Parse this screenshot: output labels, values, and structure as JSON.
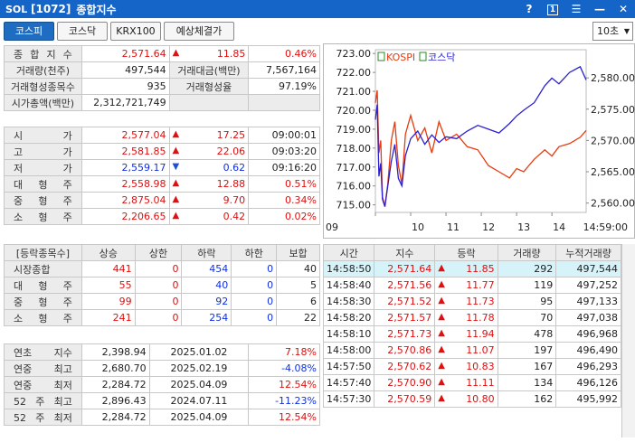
{
  "titlebar": {
    "logo": "SOL",
    "code": "[1072]",
    "title": "종합지수",
    "help": "?",
    "badge": "1",
    "menu": "☰",
    "minimize": "—",
    "close": "✕"
  },
  "tabs": [
    "코스피",
    "코스닥",
    "KRX100",
    "예상체결가"
  ],
  "interval": "10초",
  "summary": {
    "r1": {
      "l": "종 합 지 수",
      "v": "2,571.64",
      "chg": "11.85",
      "pct": "0.46%"
    },
    "r2": {
      "l1": "거래량(천주)",
      "v1": "497,544",
      "l2": "거래대금(백만)",
      "v2": "7,567,164"
    },
    "r3": {
      "l1": "거래형성종목수",
      "v1": "935",
      "l2": "거래형성율",
      "v2": "97.19%"
    },
    "r4": {
      "l1": "시가총액(백만)",
      "v1": "2,312,721,749"
    }
  },
  "ohlc": [
    {
      "l": "시 가",
      "v": "2,577.04",
      "d": "up",
      "chg": "17.25",
      "extra": "09:00:01",
      "vc": "red",
      "xc": "blk"
    },
    {
      "l": "고 가",
      "v": "2,581.85",
      "d": "up",
      "chg": "22.06",
      "extra": "09:03:20",
      "vc": "red",
      "xc": "blk"
    },
    {
      "l": "저 가",
      "v": "2,559.17",
      "d": "down",
      "chg": "0.62",
      "extra": "09:16:20",
      "vc": "blue",
      "xc": "blk"
    },
    {
      "l": "대 형 주",
      "v": "2,558.98",
      "d": "up",
      "chg": "12.88",
      "extra": "0.51%",
      "vc": "red",
      "xc": "red"
    },
    {
      "l": "중 형 주",
      "v": "2,875.04",
      "d": "up",
      "chg": "9.70",
      "extra": "0.34%",
      "vc": "red",
      "xc": "red"
    },
    {
      "l": "소 형 주",
      "v": "2,206.65",
      "d": "up",
      "chg": "0.42",
      "extra": "0.02%",
      "vc": "red",
      "xc": "red"
    }
  ],
  "breadth": {
    "headers": [
      "[등락종목수]",
      "상승",
      "상한",
      "하락",
      "하한",
      "보합"
    ],
    "rows": [
      {
        "l": "시장종합",
        "up": "441",
        "uplim": "0",
        "dn": "454",
        "dnlim": "0",
        "flat": "40"
      },
      {
        "l": "대 형 주",
        "up": "55",
        "uplim": "0",
        "dn": "40",
        "dnlim": "0",
        "flat": "5"
      },
      {
        "l": "중 형 주",
        "up": "99",
        "uplim": "0",
        "dn": "92",
        "dnlim": "0",
        "flat": "6"
      },
      {
        "l": "소 형 주",
        "up": "241",
        "uplim": "0",
        "dn": "254",
        "dnlim": "0",
        "flat": "22"
      }
    ]
  },
  "yearstats": [
    {
      "l": "연초 지수",
      "v": "2,398.94",
      "date": "2025.01.02",
      "pct": "7.18%",
      "pc": "red"
    },
    {
      "l": "연중 최고",
      "v": "2,680.70",
      "date": "2025.02.19",
      "pct": "-4.08%",
      "pc": "blue"
    },
    {
      "l": "연중 최저",
      "v": "2,284.72",
      "date": "2025.04.09",
      "pct": "12.54%",
      "pc": "red"
    },
    {
      "l": "52 주 최고",
      "v": "2,896.43",
      "date": "2024.07.11",
      "pct": "-11.23%",
      "pc": "blue"
    },
    {
      "l": "52 주 최저",
      "v": "2,284.72",
      "date": "2025.04.09",
      "pct": "12.54%",
      "pc": "red"
    }
  ],
  "ticks": {
    "headers": [
      "시간",
      "지수",
      "등락",
      "거래량",
      "누적거래량"
    ],
    "rows": [
      {
        "t": "14:58:50",
        "idx": "2,571.64",
        "chg": "11.85",
        "vol": "292",
        "cum": "497,544"
      },
      {
        "t": "14:58:40",
        "idx": "2,571.56",
        "chg": "11.77",
        "vol": "119",
        "cum": "497,252"
      },
      {
        "t": "14:58:30",
        "idx": "2,571.52",
        "chg": "11.73",
        "vol": "95",
        "cum": "497,133"
      },
      {
        "t": "14:58:20",
        "idx": "2,571.57",
        "chg": "11.78",
        "vol": "70",
        "cum": "497,038"
      },
      {
        "t": "14:58:10",
        "idx": "2,571.73",
        "chg": "11.94",
        "vol": "478",
        "cum": "496,968"
      },
      {
        "t": "14:58:00",
        "idx": "2,570.86",
        "chg": "11.07",
        "vol": "197",
        "cum": "496,490"
      },
      {
        "t": "14:57:50",
        "idx": "2,570.62",
        "chg": "10.83",
        "vol": "167",
        "cum": "496,293"
      },
      {
        "t": "14:57:40",
        "idx": "2,570.90",
        "chg": "11.11",
        "vol": "134",
        "cum": "496,126"
      },
      {
        "t": "14:57:30",
        "idx": "2,570.59",
        "chg": "10.80",
        "vol": "162",
        "cum": "495,992"
      }
    ]
  },
  "chart_data": {
    "type": "line",
    "legend": [
      "KOSPI",
      "코스닥"
    ],
    "colors": {
      "KOSPI": "#e83a0c",
      "코스닥": "#2a1fd0"
    },
    "y_left": {
      "ticks": [
        "723.00",
        "722.00",
        "721.00",
        "720.00",
        "719.00",
        "718.00",
        "717.00",
        "716.00",
        "715.00"
      ],
      "range": [
        714.6,
        723.2
      ]
    },
    "y_right": {
      "ticks": [
        "2,580.00",
        "2,575.00",
        "2,570.00",
        "2,565.00",
        "2,560.00"
      ],
      "range": [
        2558.5,
        2584.5
      ]
    },
    "x_ticks": [
      "09",
      "10",
      "11",
      "12",
      "13",
      "14",
      "14:59:00"
    ],
    "series": [
      {
        "name": "KOSPI",
        "axis": "right",
        "x": [
          9.0,
          9.05,
          9.1,
          9.15,
          9.2,
          9.27,
          9.35,
          9.45,
          9.55,
          9.65,
          9.75,
          9.85,
          10.0,
          10.2,
          10.4,
          10.6,
          10.8,
          11.0,
          11.3,
          11.6,
          11.9,
          12.2,
          12.5,
          12.8,
          13.0,
          13.2,
          13.5,
          13.8,
          14.0,
          14.2,
          14.5,
          14.8,
          14.97
        ],
        "y": [
          2576,
          2578,
          2568,
          2570,
          2561,
          2559.5,
          2563,
          2570,
          2573,
          2566,
          2563,
          2571,
          2574,
          2570,
          2572,
          2568,
          2573,
          2570,
          2571,
          2569,
          2568.5,
          2566,
          2565,
          2564,
          2565.5,
          2565,
          2567,
          2568.5,
          2567.5,
          2569,
          2569.5,
          2570.5,
          2571.6
        ]
      },
      {
        "name": "코스닥",
        "axis": "left",
        "x": [
          9.0,
          9.05,
          9.1,
          9.15,
          9.2,
          9.27,
          9.35,
          9.45,
          9.55,
          9.65,
          9.75,
          9.85,
          10.0,
          10.2,
          10.4,
          10.6,
          10.8,
          11.0,
          11.3,
          11.6,
          11.9,
          12.2,
          12.5,
          12.8,
          13.0,
          13.2,
          13.5,
          13.8,
          14.0,
          14.2,
          14.5,
          14.8,
          14.97
        ],
        "y": [
          719.5,
          720.3,
          716.5,
          717.2,
          715.3,
          714.9,
          716.0,
          717.3,
          718.2,
          716.4,
          716.0,
          717.6,
          718.5,
          718.9,
          718.2,
          718.7,
          718.3,
          718.6,
          718.5,
          718.9,
          719.2,
          719.0,
          718.8,
          719.3,
          719.7,
          720.0,
          720.4,
          721.3,
          721.7,
          721.4,
          722.0,
          722.3,
          721.6
        ]
      }
    ]
  }
}
